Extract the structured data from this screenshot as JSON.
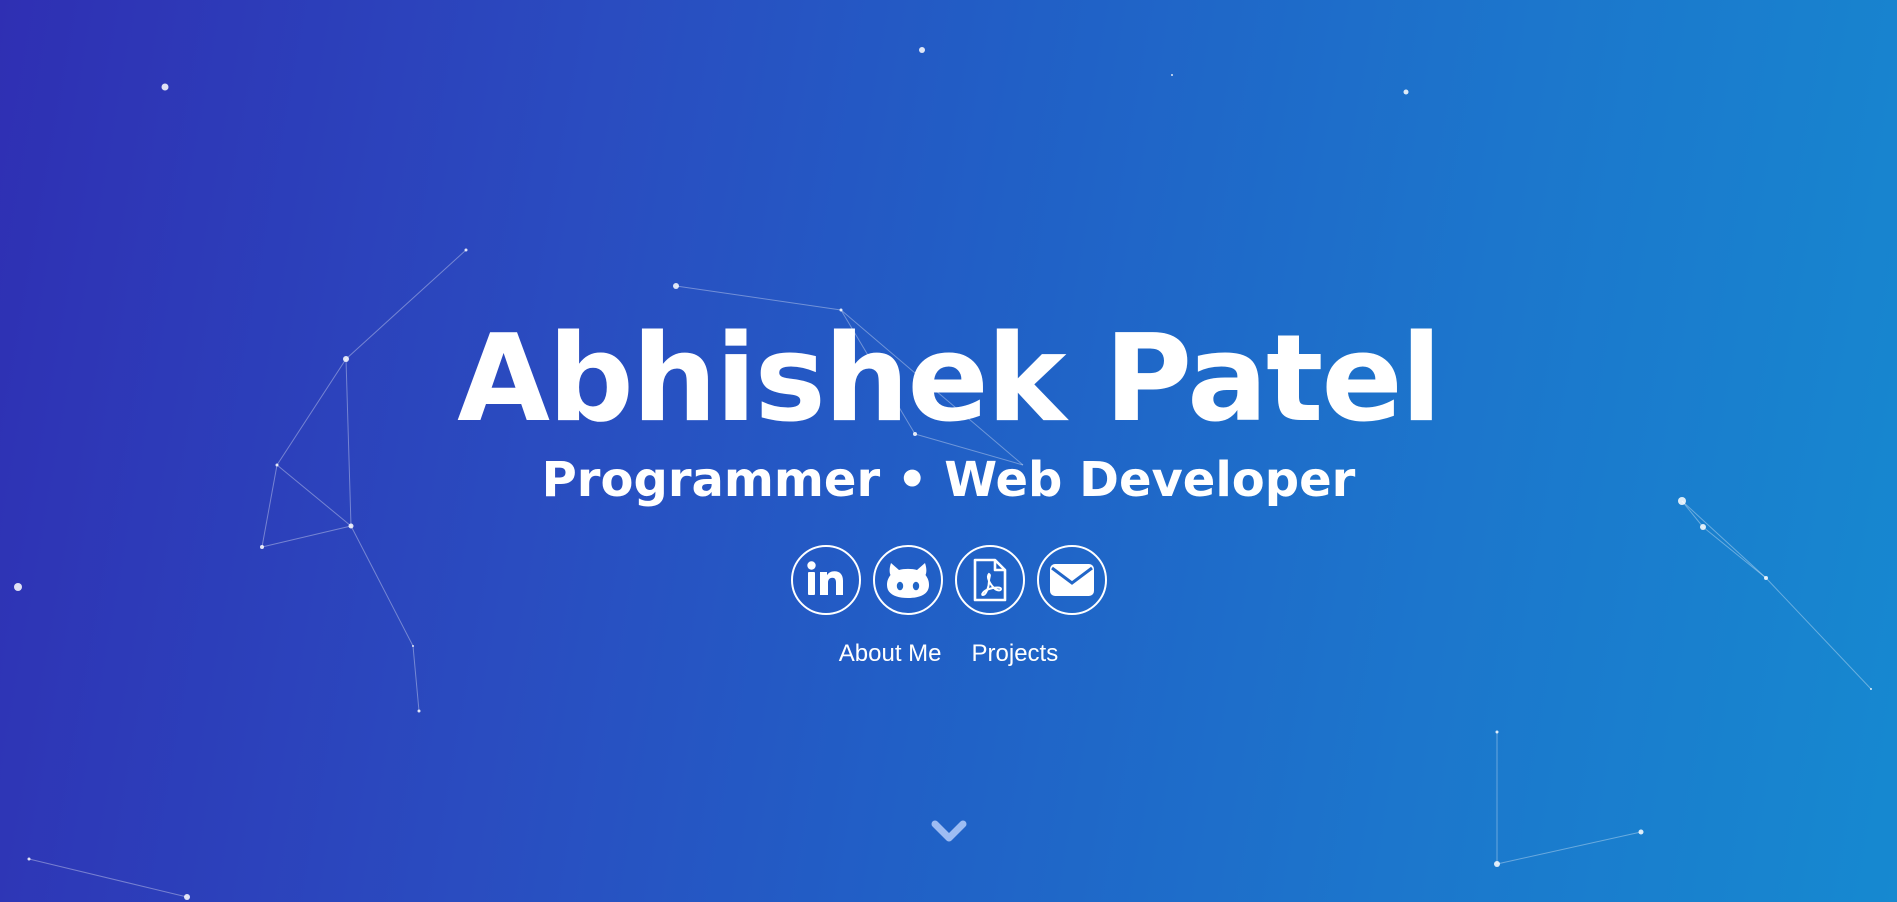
{
  "hero": {
    "name": "Abhishek Patel",
    "subtitle": "Programmer • Web Developer"
  },
  "socials": [
    {
      "name": "linkedin",
      "icon": "linkedin-icon"
    },
    {
      "name": "github",
      "icon": "github-icon"
    },
    {
      "name": "resume",
      "icon": "pdf-icon"
    },
    {
      "name": "email",
      "icon": "mail-icon"
    }
  ],
  "nav": {
    "about_label": "About Me",
    "projects_label": "Projects"
  },
  "scroll": {
    "icon": "chevron-down-icon"
  },
  "colors": {
    "gradient_start": "#2f2fb3",
    "gradient_end": "#1689d0",
    "text": "#ffffff"
  }
}
